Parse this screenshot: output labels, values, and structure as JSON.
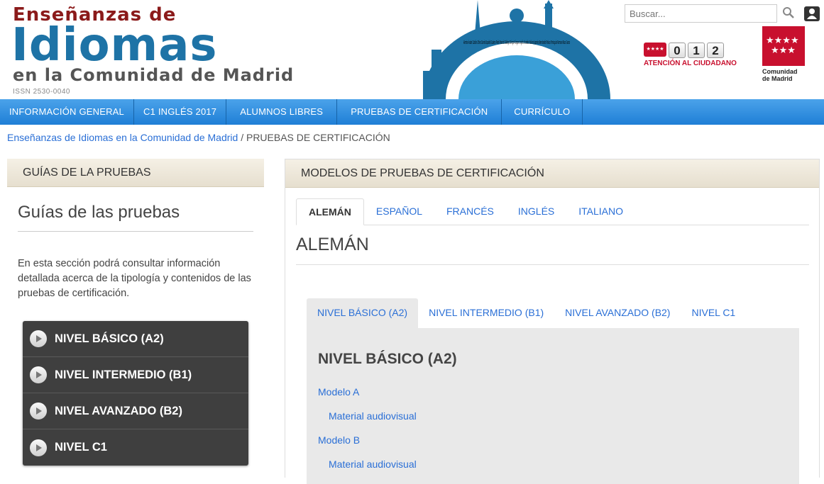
{
  "header": {
    "title_line1": "Enseñanzas de",
    "title_line2": "Idiomas",
    "title_line3": "en la Comunidad de Madrid",
    "issn": "ISSN 2530-0040",
    "search_placeholder": "Buscar...",
    "phone": {
      "digits": [
        "0",
        "1",
        "2"
      ],
      "caption": "ATENCIÓN AL CIUDADANO"
    },
    "region_logo_text": "Comunidad de Madrid",
    "globe_words": "Alemán Árabe Catalán Chino Danés Español Euskera Finés Francés Gallego Griego Húngaro Inglés Irlandés Italiano Japonés Neerlandés Polaco Portugués Rumano Ruso Sueco"
  },
  "nav": {
    "items": [
      "INFORMACIÓN GENERAL",
      "C1 INGLÉS 2017",
      "ALUMNOS LIBRES",
      "PRUEBAS DE CERTIFICACIÓN",
      "CURRÍCULO"
    ]
  },
  "breadcrumb": {
    "home": "Enseñanzas de Idiomas en la Comunidad de Madrid",
    "separator": "/",
    "current": "PRUEBAS DE CERTIFICACIÓN"
  },
  "left": {
    "heading": "GUÍAS DE LA PRUEBAS",
    "title": "Guías de las pruebas",
    "text": "En esta sección podrá consultar información detallada acerca de la tipología y contenidos de las pruebas de certificación.",
    "levels": [
      "NIVEL BÁSICO (A2)",
      "NIVEL INTERMEDIO (B1)",
      "NIVEL AVANZADO (B2)",
      "NIVEL C1"
    ]
  },
  "right": {
    "heading": "MODELOS DE PRUEBAS DE CERTIFICACIÓN",
    "lang_tabs": [
      "ALEMÁN",
      "ESPAÑOL",
      "FRANCÉS",
      "INGLÉS",
      "ITALIANO"
    ],
    "active_lang": "ALEMÁN",
    "level_tabs": [
      "NIVEL BÁSICO (A2)",
      "NIVEL INTERMEDIO (B1)",
      "NIVEL AVANZADO (B2)",
      "NIVEL C1"
    ],
    "pane_title": "NIVEL BÁSICO (A2)",
    "links": [
      {
        "label": "Modelo A"
      },
      {
        "label": "Material audiovisual"
      },
      {
        "label": "Modelo B"
      },
      {
        "label": "Material audiovisual"
      }
    ]
  },
  "colors": {
    "nav_blue": "#1f7fd6",
    "link_blue": "#2a6fd6",
    "title_red": "#8b1a1a",
    "title_blue": "#1e73a6",
    "madrid_red": "#c8102e"
  }
}
